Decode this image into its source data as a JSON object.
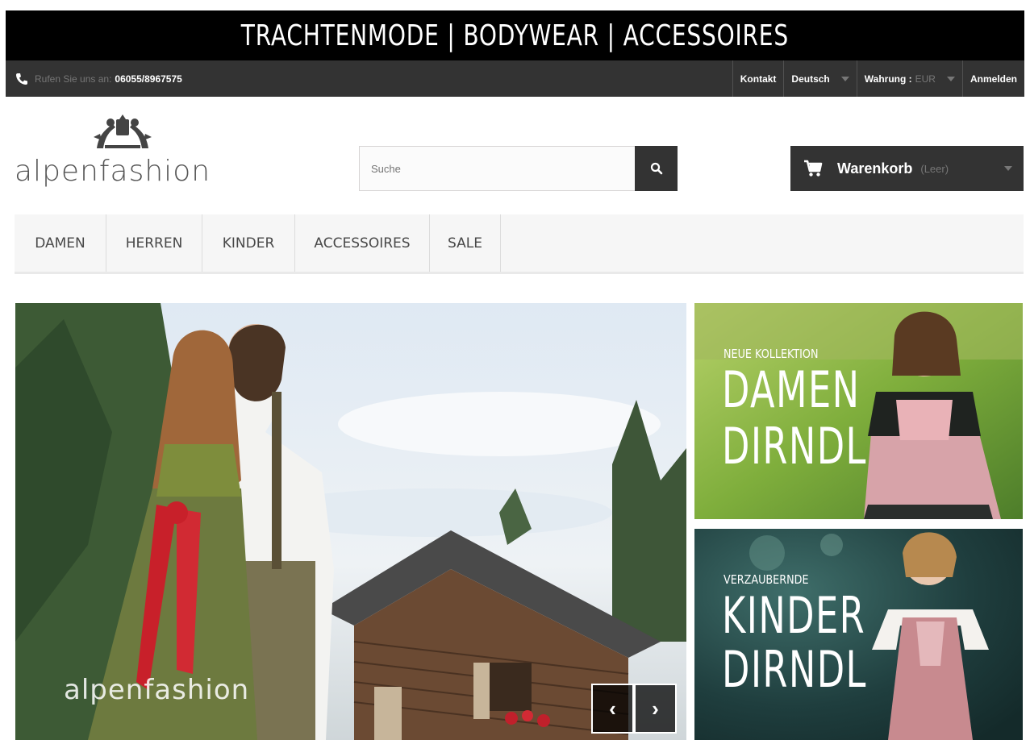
{
  "top_banner": {
    "text": "TRACHTENMODE | BODYWEAR | ACCESSOIRES"
  },
  "navbar": {
    "call_label": "Rufen Sie uns an:",
    "call_number": "06055/8967575",
    "contact": "Kontakt",
    "language": "Deutsch",
    "currency_label": "Wahrung :",
    "currency_value": "EUR",
    "login": "Anmelden"
  },
  "header": {
    "logo_text": "alpenfashion",
    "search": {
      "placeholder": "Suche"
    },
    "cart": {
      "label": "Warenkorb",
      "status": "(Leer)"
    }
  },
  "menu": {
    "items": [
      {
        "label": "DAMEN"
      },
      {
        "label": "HERREN"
      },
      {
        "label": "KINDER"
      },
      {
        "label": "ACCESSOIRES"
      },
      {
        "label": "SALE"
      }
    ]
  },
  "hero": {
    "watermark": "alpenfashion"
  },
  "banners": [
    {
      "kicker": "NEUE KOLLEKTION",
      "line1": "DAMEN",
      "line2": "DIRNDL"
    },
    {
      "kicker": "VERZAUBERNDE",
      "line1": "KINDER",
      "line2": "DIRNDL"
    }
  ],
  "colors": {
    "dark": "#333333",
    "black": "#000000",
    "menu_bg": "#f6f6f6"
  },
  "icons": [
    "phone-icon",
    "search-icon",
    "cart-icon",
    "caret-down-icon",
    "chevron-left-icon",
    "chevron-right-icon"
  ]
}
